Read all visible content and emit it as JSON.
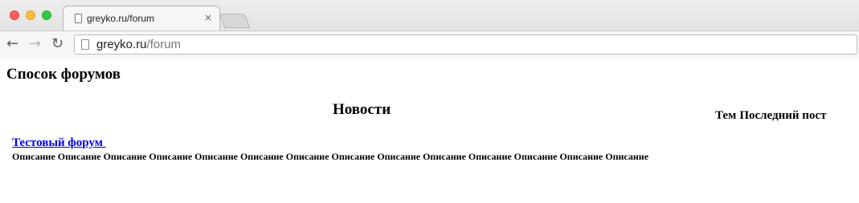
{
  "browser": {
    "tab": {
      "title": "greyko.ru/forum",
      "close_glyph": "×"
    },
    "address_bar": {
      "host": "greyko.ru",
      "path": "/forum"
    },
    "buttons": {
      "back": "←",
      "forward": "→",
      "reload": "↻"
    }
  },
  "page": {
    "title": "Спосок форумов",
    "section": {
      "title": "Новости",
      "columns": [
        "Тем",
        "Последний пост"
      ]
    },
    "forums": [
      {
        "name": "Тестовый форум ",
        "description": "Описание Описание Описание Описание Описание Описание Описание Описание Описание Описание Описание Описание Описание Описание"
      }
    ]
  }
}
